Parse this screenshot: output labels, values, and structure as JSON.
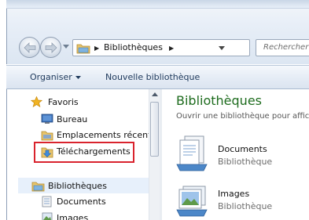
{
  "address_bar": {
    "path": "Bibliothèques",
    "search_placeholder": "Rechercher"
  },
  "toolbar": {
    "organize_label": "Organiser",
    "new_library_label": "Nouvelle bibliothèque"
  },
  "nav_pane": {
    "favorites_label": "Favoris",
    "favorites_items": [
      {
        "label": "Bureau",
        "icon": "desktop-icon"
      },
      {
        "label": "Emplacements récents",
        "icon": "recent-places-icon"
      },
      {
        "label": "Téléchargements",
        "icon": "downloads-icon"
      }
    ],
    "libraries_label": "Bibliothèques",
    "libraries_items": [
      {
        "label": "Documents",
        "icon": "documents-icon"
      },
      {
        "label": "Images",
        "icon": "images-icon"
      }
    ]
  },
  "content": {
    "title": "Bibliothèques",
    "subtitle": "Ouvrir une bibliothèque pour afficher vos fichiers",
    "libraries": [
      {
        "name": "Documents",
        "kind": "Bibliothèque",
        "icon": "documents-library-icon"
      },
      {
        "name": "Images",
        "kind": "Bibliothèque",
        "icon": "images-library-icon"
      }
    ]
  },
  "colors": {
    "title_green": "#1e6c1e",
    "highlight_red": "#d9232d",
    "toolbar_text": "#1e395b"
  }
}
